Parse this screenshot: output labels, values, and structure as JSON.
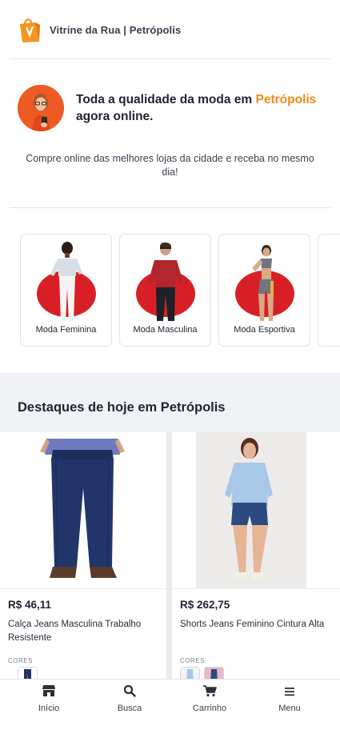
{
  "header": {
    "brand": "Vitrine da Rua | Petrópolis",
    "logo_icon": "shopping-bag-logo"
  },
  "hero": {
    "title_part1": "Toda a qualidade da moda em ",
    "title_highlight": "Petrópolis",
    "title_part2": "agora online.",
    "subtitle": "Compre online das melhores lojas da cidade e receba no mesmo dia!",
    "accent_color": "#f08a1c"
  },
  "categories": [
    {
      "label": "Moda Feminina"
    },
    {
      "label": "Moda Masculina"
    },
    {
      "label": "Moda Esportiva"
    }
  ],
  "featured": {
    "title": "Destaques de hoje em Petrópolis",
    "products": [
      {
        "price": "R$ 46,11",
        "name": "Calça Jeans Masculina Trabalho Resistente",
        "colors_label": "CORES"
      },
      {
        "price": "R$ 262,75",
        "name": "Shorts Jeans Feminino Cintura Alta",
        "colors_label": "CORES"
      }
    ]
  },
  "nav": [
    {
      "label": "Início",
      "icon": "store-icon"
    },
    {
      "label": "Busca",
      "icon": "search-icon"
    },
    {
      "label": "Carrinho",
      "icon": "cart-icon"
    },
    {
      "label": "Menu",
      "icon": "menu-icon"
    }
  ]
}
